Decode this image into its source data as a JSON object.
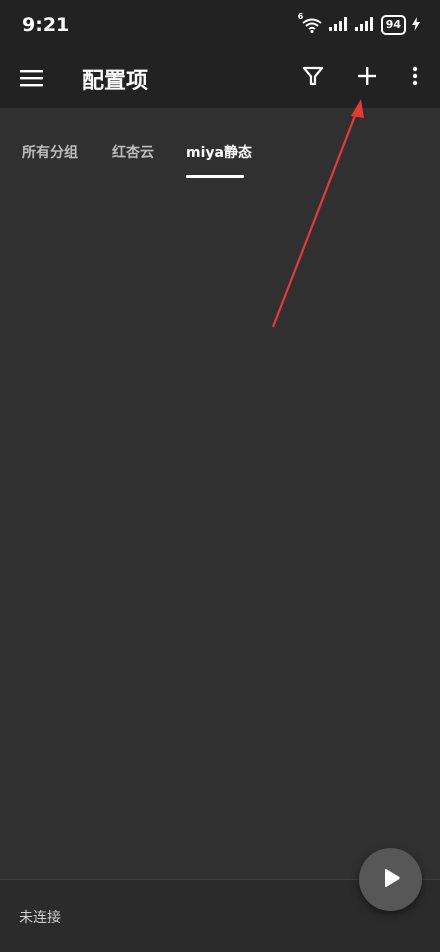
{
  "status_bar": {
    "time": "9:21",
    "wifi_badge": "6",
    "battery_level": "94",
    "icons": [
      "wifi-icon",
      "signal-icon",
      "signal-icon",
      "battery-icon",
      "charging-icon"
    ]
  },
  "app_bar": {
    "title": "配置项",
    "icons": [
      "menu-icon",
      "filter-icon",
      "add-icon",
      "more-vert-icon"
    ]
  },
  "tabs": [
    {
      "label": "所有分组",
      "selected": false
    },
    {
      "label": "红杏云",
      "selected": false
    },
    {
      "label": "miya静态",
      "selected": true
    }
  ],
  "bottom_bar": {
    "connection_status": "未连接",
    "fab_icon": "play-icon"
  },
  "annotation": {
    "type": "arrow",
    "color": "#e53935",
    "points_to": "add-button"
  }
}
